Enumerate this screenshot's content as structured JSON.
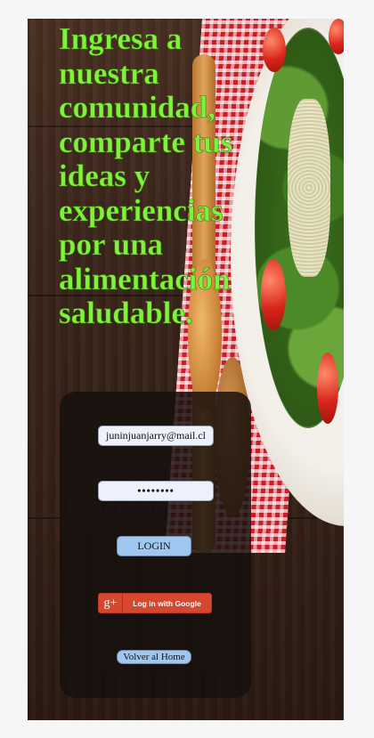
{
  "hero": {
    "headline": "Ingresa a nuestra comunidad, comparte tus ideas y experiencias por una alimentación saludable."
  },
  "login_form": {
    "email_value": "juninjuanjarry@mail.cl",
    "password_value": "••••••••",
    "login_label": "LOGIN",
    "google_icon": "g+",
    "google_label": "Log in with Google",
    "home_label": "Volver al Home"
  },
  "colors": {
    "headline": "#7ff23a",
    "panel": "#16100d",
    "button": "#9fc7f0",
    "google": "#d5482f"
  }
}
